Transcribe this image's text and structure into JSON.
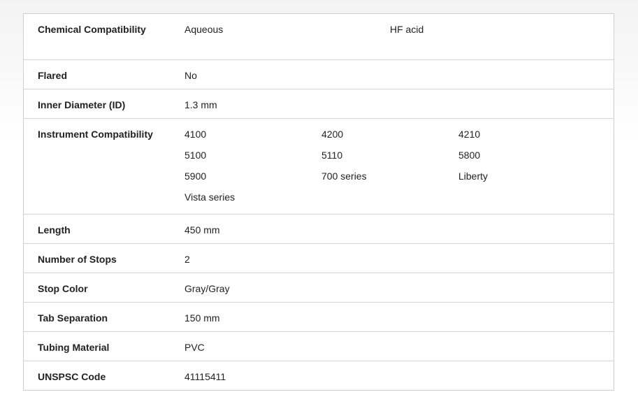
{
  "rows": {
    "chemical": {
      "label": "Chemical Compatibility",
      "values": [
        "Aqueous",
        "HF acid"
      ]
    },
    "flared": {
      "label": "Flared",
      "value": "No"
    },
    "inner_diameter": {
      "label": "Inner Diameter (ID)",
      "value": "1.3 mm"
    },
    "instrument": {
      "label": "Instrument Compatibility",
      "values": [
        "4100",
        "4200",
        "4210",
        "5100",
        "5110",
        "5800",
        "5900",
        "700 series",
        "Liberty",
        "Vista series"
      ]
    },
    "length": {
      "label": "Length",
      "value": "450 mm"
    },
    "stops": {
      "label": "Number of Stops",
      "value": "2"
    },
    "stop_color": {
      "label": "Stop Color",
      "value": "Gray/Gray"
    },
    "tab_sep": {
      "label": "Tab Separation",
      "value": "150 mm"
    },
    "tubing": {
      "label": "Tubing Material",
      "value": "PVC"
    },
    "unspsc": {
      "label": "UNSPSC Code",
      "value": "41115411"
    }
  }
}
